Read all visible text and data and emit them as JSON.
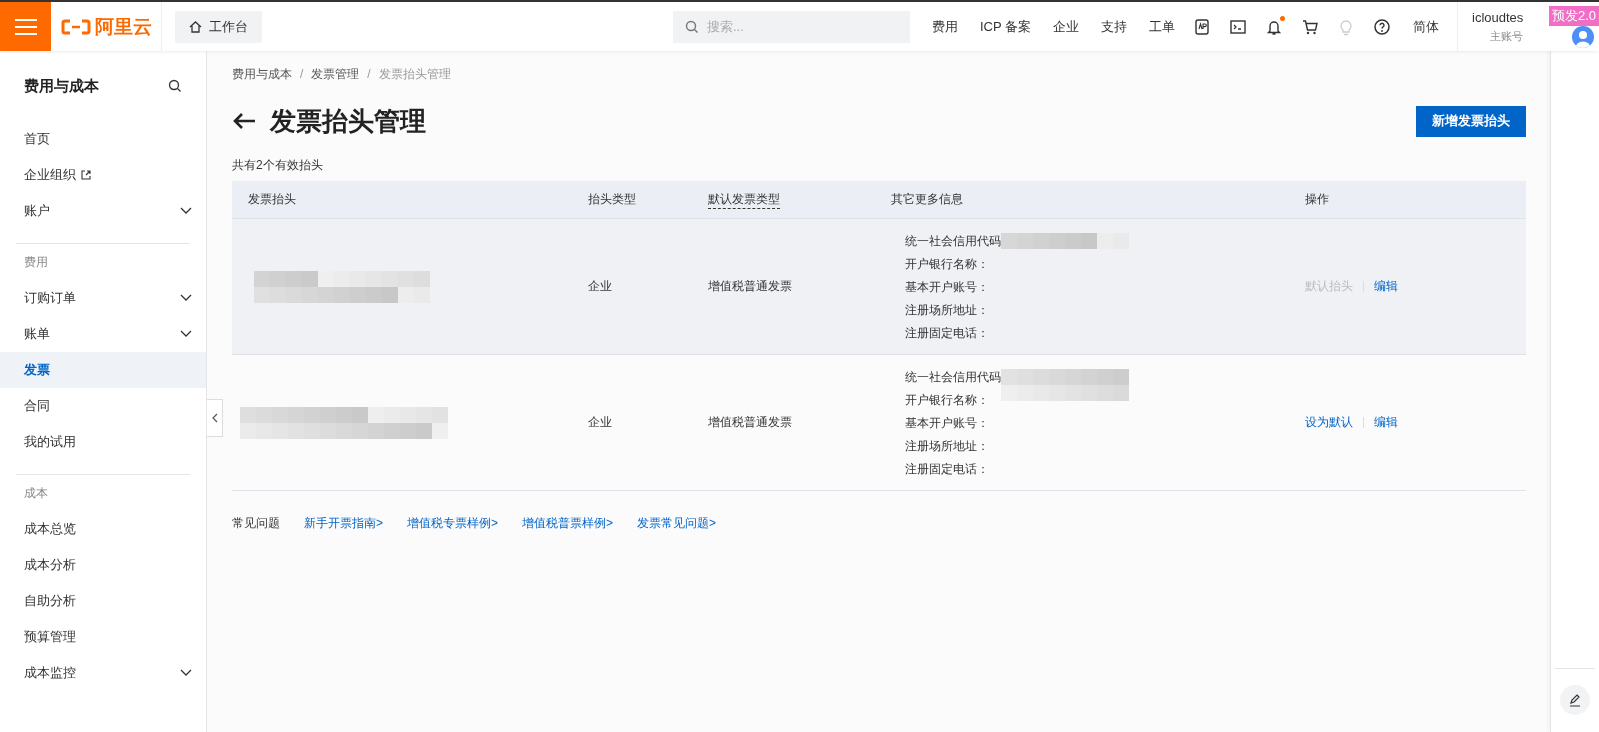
{
  "header": {
    "logo_text": "阿里云",
    "workbench": "工作台",
    "search": {
      "placeholder": "搜索..."
    },
    "nav": [
      "费用",
      "ICP 备案",
      "企业",
      "支持",
      "工单"
    ],
    "icons": [
      {
        "kind": "app",
        "badge": false,
        "disabled": false
      },
      {
        "kind": "terminal",
        "badge": false,
        "disabled": false
      },
      {
        "kind": "bell",
        "badge": true,
        "disabled": false
      },
      {
        "kind": "cart",
        "badge": false,
        "disabled": false
      },
      {
        "kind": "bulb",
        "badge": false,
        "disabled": true
      },
      {
        "kind": "help",
        "badge": false,
        "disabled": false
      }
    ],
    "language": "简体",
    "user": {
      "name": "icloudtes",
      "role": "主账号"
    },
    "env_badge": "预发2.0"
  },
  "sidebar": {
    "title": "费用与成本",
    "groups": [
      {
        "items": [
          {
            "label": "首页",
            "selected": false
          },
          {
            "label": "企业组织",
            "selected": false,
            "external": true
          },
          {
            "label": "账户",
            "selected": false,
            "expanded": false
          }
        ]
      },
      {
        "heading": "费用",
        "items": [
          {
            "label": "订购订单",
            "selected": false,
            "expanded": false
          },
          {
            "label": "账单",
            "selected": false,
            "expanded": false
          },
          {
            "label": "发票",
            "selected": true
          },
          {
            "label": "合同",
            "selected": false
          },
          {
            "label": "我的试用",
            "selected": false
          }
        ]
      },
      {
        "heading": "成本",
        "items": [
          {
            "label": "成本总览",
            "selected": false
          },
          {
            "label": "成本分析",
            "selected": false
          },
          {
            "label": "自助分析",
            "selected": false
          },
          {
            "label": "预算管理",
            "selected": false
          },
          {
            "label": "成本监控",
            "selected": false,
            "expanded": false
          }
        ]
      }
    ]
  },
  "breadcrumb": [
    "费用与成本",
    "发票管理",
    "发票抬头管理"
  ],
  "breadcrumb_separator": "/",
  "page_title": "发票抬头管理",
  "primary_button": "新增发票抬头",
  "count_text": "共有2个有效抬头",
  "table": {
    "columns": [
      "发票抬头",
      "抬头类型",
      "默认发票类型",
      "其它更多信息",
      "操作"
    ],
    "rows": [
      {
        "highlighted": true,
        "type": "企业",
        "invoice_type": "增值税普通发票",
        "info": [
          "统一社会信用代码",
          "开户银行名称：",
          "基本开户账号：",
          "注册场所地址：",
          "注册固定电话："
        ],
        "actions": [
          {
            "label": "默认抬头",
            "disabled": true
          },
          {
            "label": "编辑",
            "disabled": false
          }
        ]
      },
      {
        "highlighted": false,
        "type": "企业",
        "invoice_type": "增值税普通发票",
        "info": [
          "统一社会信用代码",
          "开户银行名称：",
          "基本开户账号：",
          "注册场所地址：",
          "注册固定电话："
        ],
        "actions": [
          {
            "label": "设为默认",
            "disabled": false
          },
          {
            "label": "编辑",
            "disabled": false
          }
        ]
      }
    ]
  },
  "faq": {
    "label": "常见问题",
    "links": [
      "新手开票指南>",
      "增值税专票样例>",
      "增值税普票样例>",
      "发票常见问题>"
    ]
  }
}
